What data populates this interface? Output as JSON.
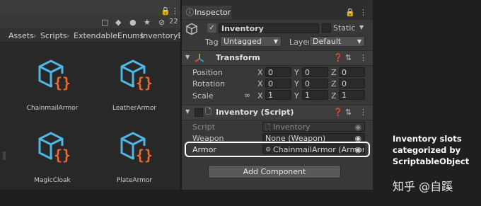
{
  "project": {
    "top_count": "22",
    "breadcrumb": [
      "Assets",
      "Scripts",
      "ExtendableEnums",
      "InventoryEx"
    ],
    "assets": [
      {
        "name": "ChainmailArmor"
      },
      {
        "name": "LeatherArmor"
      },
      {
        "name": "MagicCloak"
      },
      {
        "name": "PlateArmor"
      }
    ]
  },
  "inspector": {
    "tab_label": "Inspector",
    "object_name": "Inventory",
    "static_label": "Static",
    "tag_label": "Tag",
    "tag_value": "Untagged",
    "layer_label": "Layer",
    "layer_value": "Default",
    "transform": {
      "title": "Transform",
      "rows": [
        {
          "label": "Position",
          "x": "0",
          "y": "0",
          "z": "0"
        },
        {
          "label": "Rotation",
          "x": "0",
          "y": "0",
          "z": "0"
        },
        {
          "label": "Scale",
          "x": "1",
          "y": "1",
          "z": "1"
        }
      ],
      "axis": {
        "x": "X",
        "y": "Y",
        "z": "Z"
      }
    },
    "script_component": {
      "title": "Inventory (Script)",
      "script_label": "Script",
      "script_value": "Inventory",
      "weapon_label": "Weapon",
      "weapon_value": "None (Weapon)",
      "armor_label": "Armor",
      "armor_value": "ChainmailArmor (Armor)"
    },
    "add_component": "Add Component"
  },
  "annotation": {
    "lines": [
      "Inventory slots",
      "categorized by",
      "ScriptableObject"
    ]
  },
  "watermark": "知乎 @自蹊",
  "colors": {
    "icon_cube": "#4fb7e6",
    "icon_braces": "#f0682e",
    "highlight_border": "#ffffff"
  }
}
